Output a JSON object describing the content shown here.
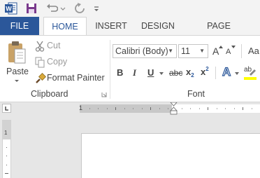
{
  "quick_access": {
    "app_icon": "word-app-icon",
    "save_icon": "save-icon",
    "undo_icon": "undo-icon",
    "undo_dropdown_icon": "chevron-down-icon",
    "redo_icon": "redo-icon",
    "customize_icon": "customize-qat-icon"
  },
  "tabs": [
    {
      "label": "FILE"
    },
    {
      "label": "HOME"
    },
    {
      "label": "INSERT"
    },
    {
      "label": "DESIGN"
    },
    {
      "label": "PAGE LAYOUT"
    }
  ],
  "clipboard": {
    "paste_label": "Paste",
    "cut_label": "Cut",
    "copy_label": "Copy",
    "format_painter_label": "Format Painter",
    "group_label": "Clipboard"
  },
  "font": {
    "font_name": "Calibri (Body)",
    "font_size": "11",
    "grow_label": "A",
    "shrink_label": "A",
    "case_label": "Aa",
    "bold_label": "B",
    "italic_label": "I",
    "underline_label": "U",
    "strike_label": "abc",
    "subscript_label": "x",
    "subscript_mark": "2",
    "superscript_label": "x",
    "superscript_mark": "2",
    "effects_label": "A",
    "highlight_label": "ab",
    "group_label": "Font"
  },
  "ruler": {
    "h_number": "1",
    "v_number": "1"
  },
  "colors": {
    "accent": "#2b579a",
    "highlight": "#ffff00"
  }
}
